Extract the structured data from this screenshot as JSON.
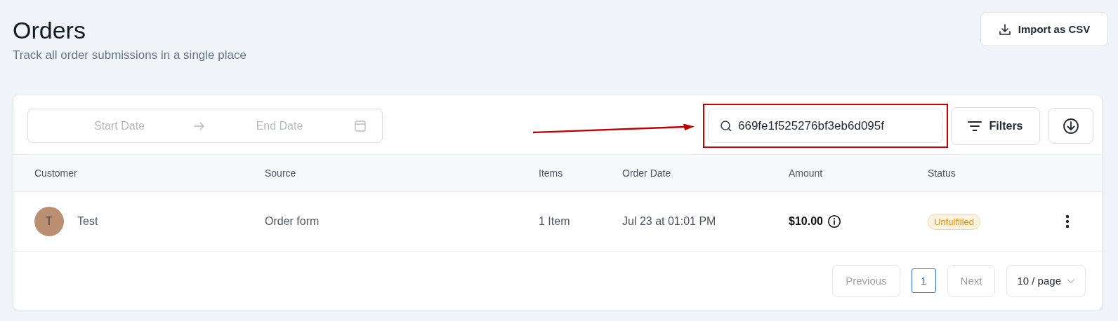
{
  "header": {
    "title": "Orders",
    "subtitle": "Track all order submissions in a single place",
    "import_button": "Import as CSV"
  },
  "toolbar": {
    "date_range": {
      "start_placeholder": "Start Date",
      "end_placeholder": "End Date"
    },
    "search": {
      "value": "669fe1f525276bf3eb6d095f",
      "highlighted": true
    },
    "filters_button": "Filters"
  },
  "table": {
    "columns": [
      "Customer",
      "Source",
      "Items",
      "Order Date",
      "Amount",
      "Status"
    ],
    "rows": [
      {
        "avatar": "T",
        "customer": "Test",
        "source": "Order form",
        "items": "1 Item",
        "order_date": "Jul 23 at 01:01 PM",
        "amount": "$10.00",
        "status": {
          "label": "Unfulfilled",
          "kind": "warning"
        }
      }
    ]
  },
  "pagination": {
    "previous": {
      "label": "Previous",
      "disabled": true
    },
    "pages": [
      {
        "label": "1",
        "selected": true
      }
    ],
    "next": {
      "label": "Next",
      "disabled": true
    },
    "page_size": "10 / page"
  }
}
